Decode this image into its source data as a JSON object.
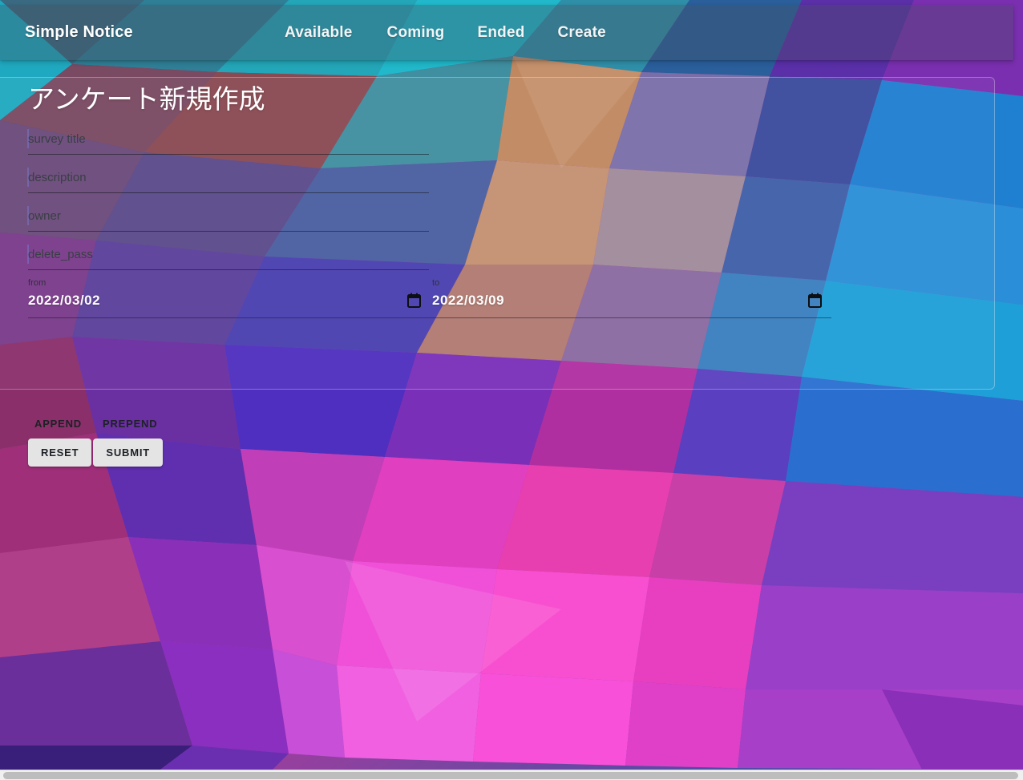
{
  "nav": {
    "brand": "Simple Notice",
    "links": [
      {
        "label": "Available"
      },
      {
        "label": "Coming"
      },
      {
        "label": "Ended"
      },
      {
        "label": "Create"
      }
    ]
  },
  "card": {
    "title": "アンケート新規作成"
  },
  "form": {
    "fields": [
      {
        "name": "survey_title",
        "placeholder": "survey title",
        "value": ""
      },
      {
        "name": "description",
        "placeholder": "description",
        "value": ""
      },
      {
        "name": "owner",
        "placeholder": "owner",
        "value": ""
      },
      {
        "name": "delete_pass",
        "placeholder": "delete_pass",
        "value": ""
      }
    ],
    "date_from": {
      "label": "from",
      "value": "2022/03/02",
      "icon": "calendar-icon"
    },
    "date_to": {
      "label": "to",
      "value": "2022/03/09",
      "icon": "calendar-icon"
    }
  },
  "actions": {
    "append_label": "APPEND",
    "prepend_label": "PREPEND",
    "reset_label": "RESET",
    "submit_label": "SUBMIT"
  },
  "colors": {
    "button_bg": "#e4e4e4",
    "button_text": "#1d2126",
    "nav_text": "#f2f4f6",
    "card_title": "#ffffff",
    "date_value": "#ffffff",
    "placeholder": "#3a3f46"
  }
}
